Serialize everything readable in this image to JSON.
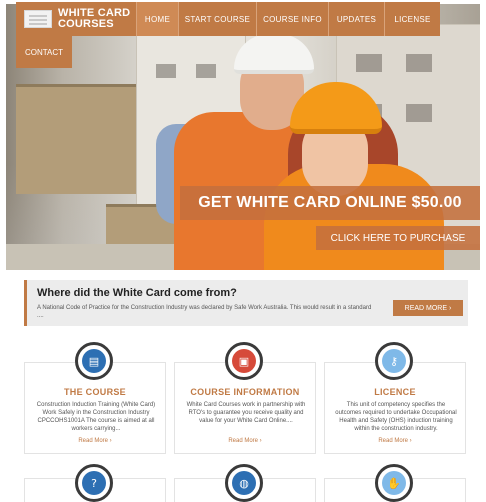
{
  "brand": {
    "line1": "WHITE CARD",
    "line2": "COURSES"
  },
  "nav": {
    "items": [
      {
        "label": "HOME",
        "active": true
      },
      {
        "label": "START COURSE",
        "active": false
      },
      {
        "label": "COURSE INFO",
        "active": false
      },
      {
        "label": "UPDATES",
        "active": false
      },
      {
        "label": "LICENSE",
        "active": false
      }
    ],
    "contact": "CONTACT"
  },
  "hero": {
    "headline": "GET WHITE CARD ONLINE $50.00",
    "cta": "CLICK HERE TO PURCHASE"
  },
  "info": {
    "title": "Where did the White Card come from?",
    "text": "A National Code of Practice for the Construction Industry was declared by Safe Work Australia. This would result in a standard ....",
    "button": "READ MORE"
  },
  "cards": [
    {
      "icon": "id-card-icon",
      "title": "THE COURSE",
      "text": "Construction Induction Training (White Card) Work Safely in the Construction Industry CPCCOHS1001A The course is aimed at all workers carrying...",
      "link": "Read More"
    },
    {
      "icon": "monitor-icon",
      "title": "COURSE INFORMATION",
      "text": "White Card Courses work in partnership with RTO's to guarantee you receive quality and value for your White Card Online....",
      "link": "Read More"
    },
    {
      "icon": "key-icon",
      "title": "LICENCE",
      "text": "This unit of competency specifies the outcomes required to undertake Occupational Health and Safety (OHS) induction training within the construction industry.",
      "link": "Read More"
    }
  ],
  "icons": {
    "row2": [
      "question-icon",
      "globe-icon",
      "handshake-icon"
    ]
  },
  "colors": {
    "accent": "#c07a45",
    "icon_ring": "#3a3a3a"
  }
}
